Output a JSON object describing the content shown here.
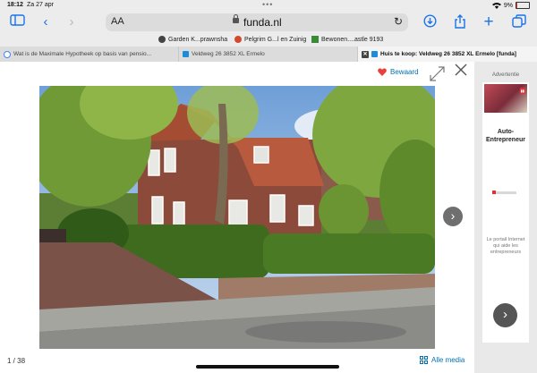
{
  "statusbar": {
    "time": "18:12",
    "date": "Za 27 apr",
    "battery": "9%",
    "battery_level": 0.09
  },
  "browser": {
    "text_size_label": "AA",
    "url": "funda.nl",
    "favorites": [
      {
        "label": "Garden K...prawnsha",
        "icon_color": "#444444"
      },
      {
        "label": "Pelgrim G...l en Zuinig",
        "icon_color": "#d04a2f"
      },
      {
        "label": "Bewonen....astle 9193",
        "icon_color": "#3a8a3a"
      }
    ],
    "tabs": [
      {
        "label": "Wat is de Maximale Hypotheek op basis van pensio...",
        "icon": "google-icon",
        "active": false
      },
      {
        "label": "Veldweg 26 3852 XL Ermelo",
        "icon": "funda-icon",
        "active": false
      },
      {
        "label": "Huis te koop: Veldweg 26 3852 XL Ermelo [funda]",
        "icon": "funda-icon",
        "active": true
      }
    ]
  },
  "viewer": {
    "bewaard_label": "Bewaard",
    "counter": "1 / 38",
    "all_media_label": "Alle media"
  },
  "ad": {
    "label": "Advertentie",
    "heading": "Auto-Entrepreneur",
    "body": "Le portail Internet qui aide les entrepreneurs"
  },
  "colors": {
    "link": "#0071b3",
    "heart": "#e8413b",
    "browser_blue": "#1a73e8"
  }
}
